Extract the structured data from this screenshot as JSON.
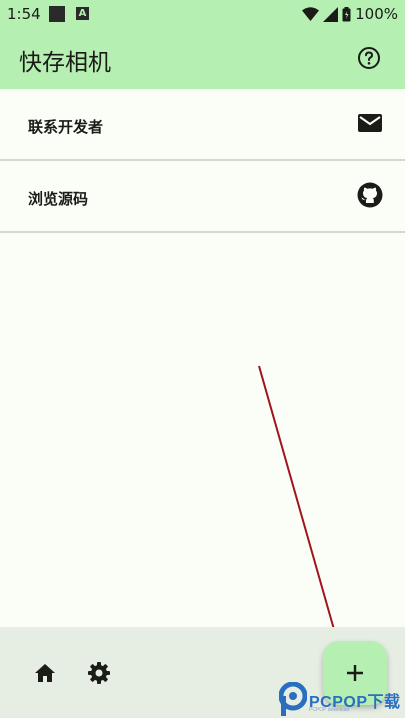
{
  "status": {
    "time": "1:54",
    "battery": "100%",
    "icons": [
      "notification-square-icon",
      "app-a-icon",
      "wifi-icon",
      "signal-icon",
      "battery-icon"
    ]
  },
  "app_bar": {
    "title": "快存相机",
    "help_icon": "help-circle-icon"
  },
  "list": {
    "items": [
      {
        "label": "联系开发者",
        "icon": "email-icon"
      },
      {
        "label": "浏览源码",
        "icon": "github-icon"
      }
    ]
  },
  "bottom_bar": {
    "home_icon": "home-icon",
    "settings_icon": "gear-icon",
    "fab_icon": "plus-icon"
  },
  "watermark": {
    "text": "PCPOP下载",
    "sub": "PCPOP download"
  },
  "colors": {
    "primary_container": "#b5efb2",
    "background": "#fbfdf7",
    "bottom_bar": "#e6ede2",
    "arrow": "#a0141e",
    "watermark": "#2a6ec0"
  }
}
